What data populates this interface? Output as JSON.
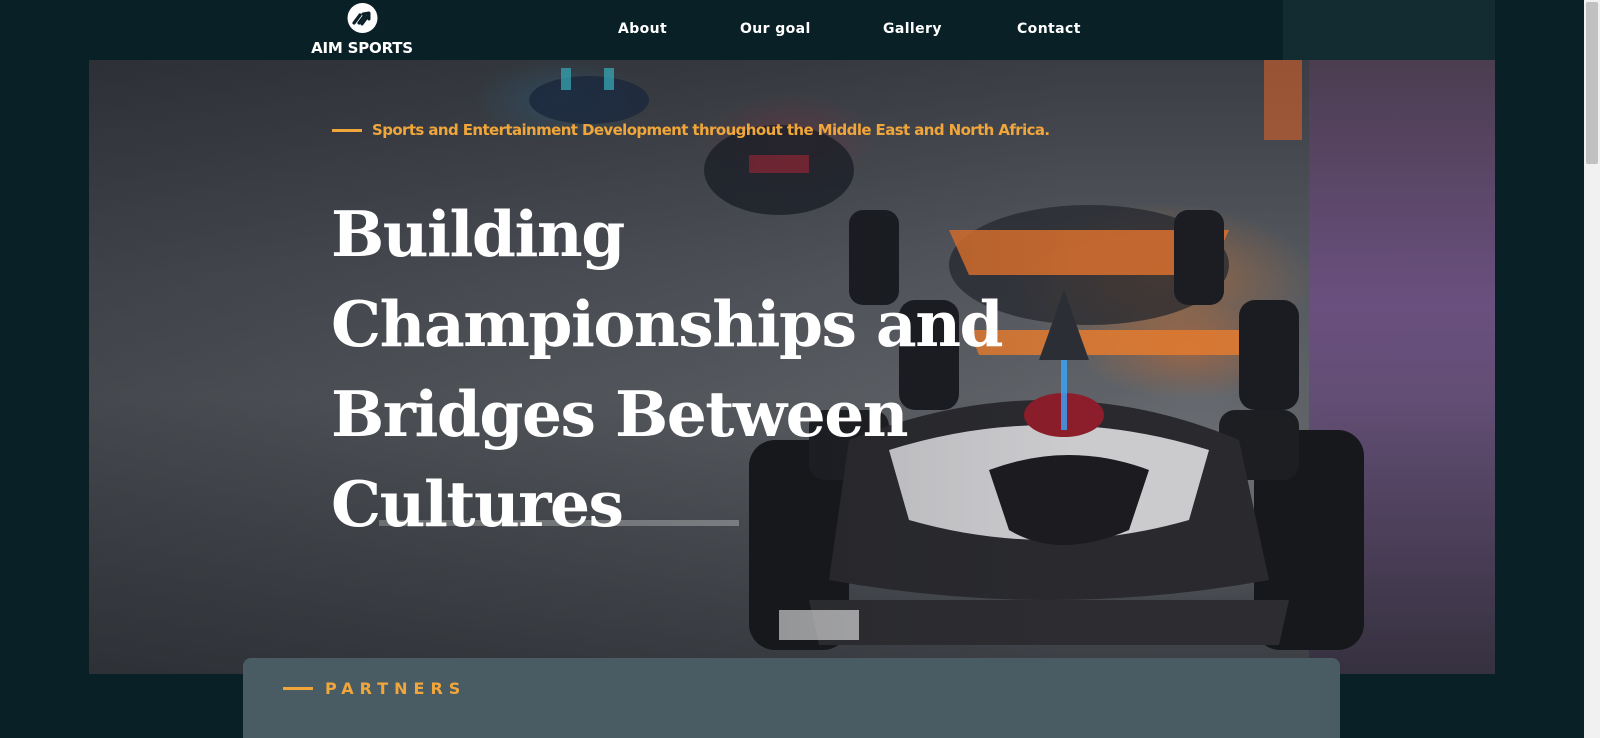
{
  "header": {
    "logo_text": "AIM SPORTS",
    "logo_icon": "double-chevron-circle-icon",
    "nav": [
      {
        "label": "About"
      },
      {
        "label": "Our goal"
      },
      {
        "label": "Gallery"
      },
      {
        "label": "Contact"
      }
    ]
  },
  "hero": {
    "tagline": "Sports and Entertainment Development throughout the Middle East and North Africa.",
    "title_lines": [
      "Building",
      "Championships and",
      "Bridges Between",
      "Cultures"
    ]
  },
  "partners": {
    "label": "PARTNERS"
  },
  "colors": {
    "page_background": "#0a2027",
    "accent": "#f0a63a",
    "partners_panel": "#4a5c63",
    "text": "#ffffff"
  }
}
